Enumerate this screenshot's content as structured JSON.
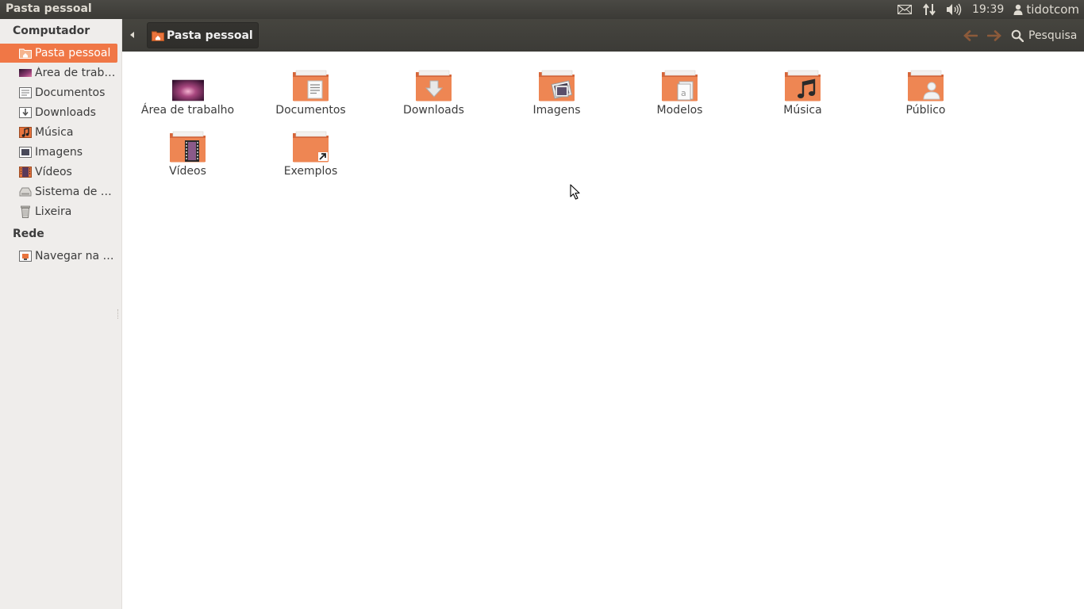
{
  "window": {
    "title": "Pasta pessoal"
  },
  "top_panel": {
    "indicators": [
      {
        "icon": "mail-icon"
      },
      {
        "icon": "network-icon"
      },
      {
        "icon": "volume-icon"
      }
    ],
    "clock": "19:39",
    "user": "tidotcom"
  },
  "sidebar": {
    "computer_header": "Computador",
    "items": [
      {
        "label": "Pasta pessoal",
        "icon": "home-folder-icon",
        "active": true
      },
      {
        "label": "Área de trabalho",
        "icon": "desktop-icon"
      },
      {
        "label": "Documentos",
        "icon": "documents-folder-icon"
      },
      {
        "label": "Downloads",
        "icon": "downloads-folder-icon"
      },
      {
        "label": "Música",
        "icon": "music-folder-icon"
      },
      {
        "label": "Imagens",
        "icon": "pictures-folder-icon"
      },
      {
        "label": "Vídeos",
        "icon": "videos-folder-icon"
      },
      {
        "label": "Sistema de arquivos",
        "icon": "filesystem-icon"
      },
      {
        "label": "Lixeira",
        "icon": "trash-icon"
      }
    ],
    "network_header": "Rede",
    "network_items": [
      {
        "label": "Navegar na rede",
        "icon": "network-folder-icon"
      }
    ]
  },
  "toolbar": {
    "breadcrumb": "Pasta pessoal",
    "search_label": "Pesquisa"
  },
  "content": {
    "items": [
      {
        "label": "Área de trabalho",
        "icon": "desktop-icon"
      },
      {
        "label": "Documentos",
        "icon": "documents-folder-icon"
      },
      {
        "label": "Downloads",
        "icon": "downloads-folder-icon"
      },
      {
        "label": "Imagens",
        "icon": "pictures-folder-icon"
      },
      {
        "label": "Modelos",
        "icon": "templates-folder-icon"
      },
      {
        "label": "Música",
        "icon": "music-folder-icon"
      },
      {
        "label": "Público",
        "icon": "public-folder-icon"
      },
      {
        "label": "Vídeos",
        "icon": "videos-folder-icon"
      },
      {
        "label": "Exemplos",
        "icon": "examples-link-folder-icon"
      }
    ]
  },
  "colors": {
    "accent": "#f07746",
    "panel": "#3c3b37",
    "sidebar_bg": "#efedeb",
    "folder": "#e9743d"
  }
}
